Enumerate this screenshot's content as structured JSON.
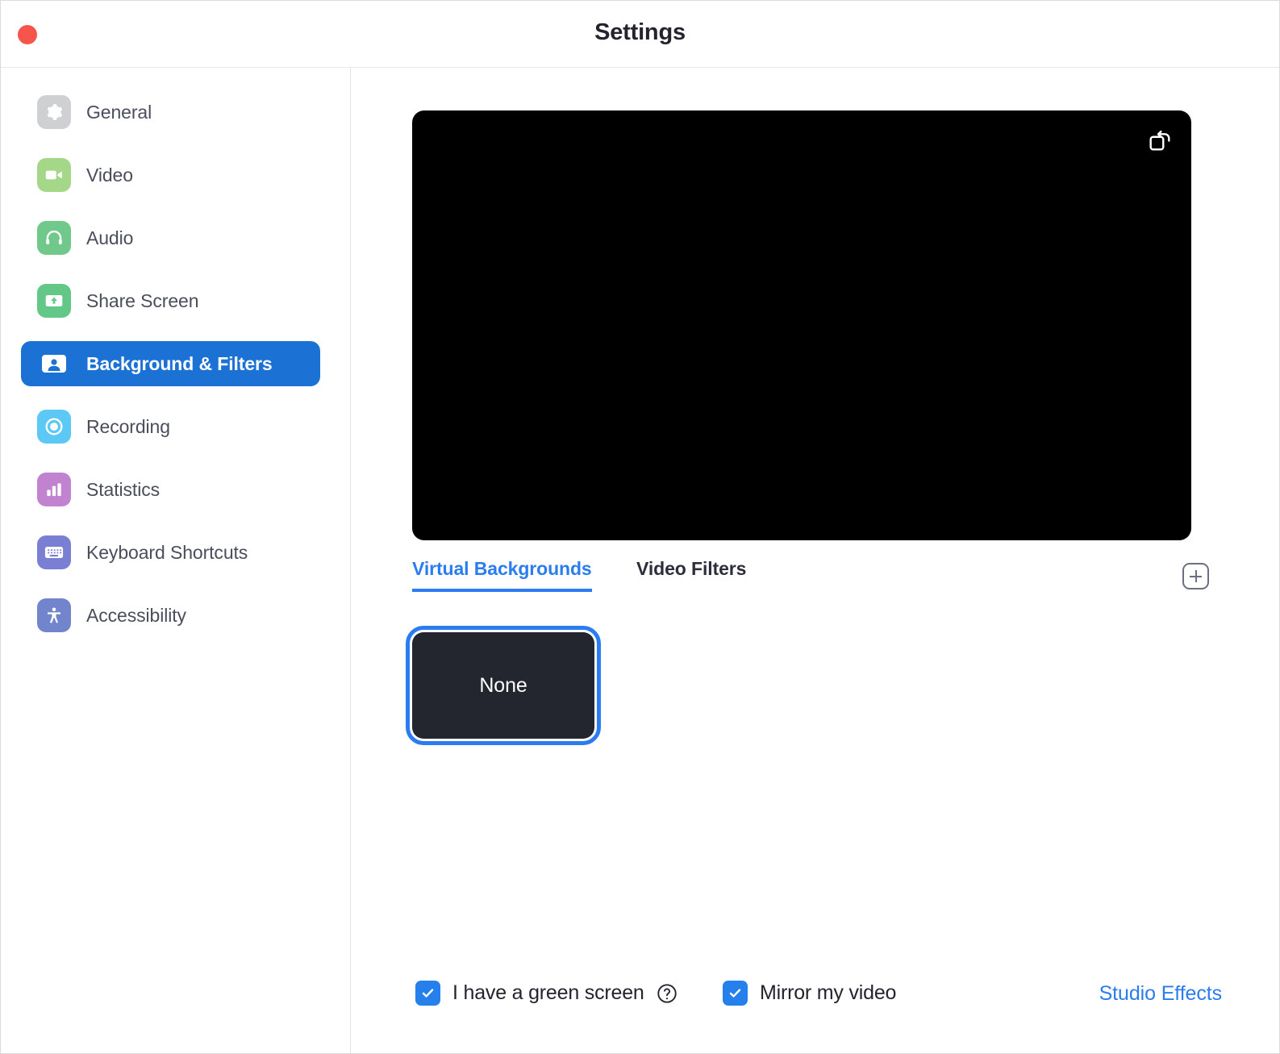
{
  "window": {
    "title": "Settings",
    "close_button": "close"
  },
  "sidebar": {
    "items": [
      {
        "label": "General",
        "icon": "gear-icon",
        "color": "#cfd0d2",
        "selected": false
      },
      {
        "label": "Video",
        "icon": "camera-icon",
        "color": "#a5d789",
        "selected": false
      },
      {
        "label": "Audio",
        "icon": "headphones-icon",
        "color": "#70c88a",
        "selected": false
      },
      {
        "label": "Share Screen",
        "icon": "upload-icon",
        "color": "#63c887",
        "selected": false
      },
      {
        "label": "Background & Filters",
        "icon": "person-icon",
        "color": "#ffffff",
        "selected": true
      },
      {
        "label": "Recording",
        "icon": "record-icon",
        "color": "#5bc8f5",
        "selected": false
      },
      {
        "label": "Statistics",
        "icon": "bar-chart-icon",
        "color": "#c183cf",
        "selected": false
      },
      {
        "label": "Keyboard Shortcuts",
        "icon": "keyboard-icon",
        "color": "#7b7fd4",
        "selected": false
      },
      {
        "label": "Accessibility",
        "icon": "accessibility-icon",
        "color": "#7285cc",
        "selected": false
      }
    ],
    "selected_bg": "#1c72d4"
  },
  "main": {
    "preview": {
      "background_color": "#000000",
      "rotate_icon": "rotate-camera-icon"
    },
    "tabs": [
      {
        "label": "Virtual Backgrounds",
        "active": true
      },
      {
        "label": "Video Filters",
        "active": false
      }
    ],
    "add_button": "add-background-button",
    "backgrounds": [
      {
        "label": "None",
        "selected": true
      }
    ],
    "accent_color": "#2b7cf0"
  },
  "footer": {
    "green_screen": {
      "label": "I have a green screen",
      "checked": true,
      "help_icon": "help-circle-icon"
    },
    "mirror_video": {
      "label": "Mirror my video",
      "checked": true
    },
    "studio_effects": {
      "label": "Studio Effects",
      "color": "#2b7cf0"
    }
  }
}
